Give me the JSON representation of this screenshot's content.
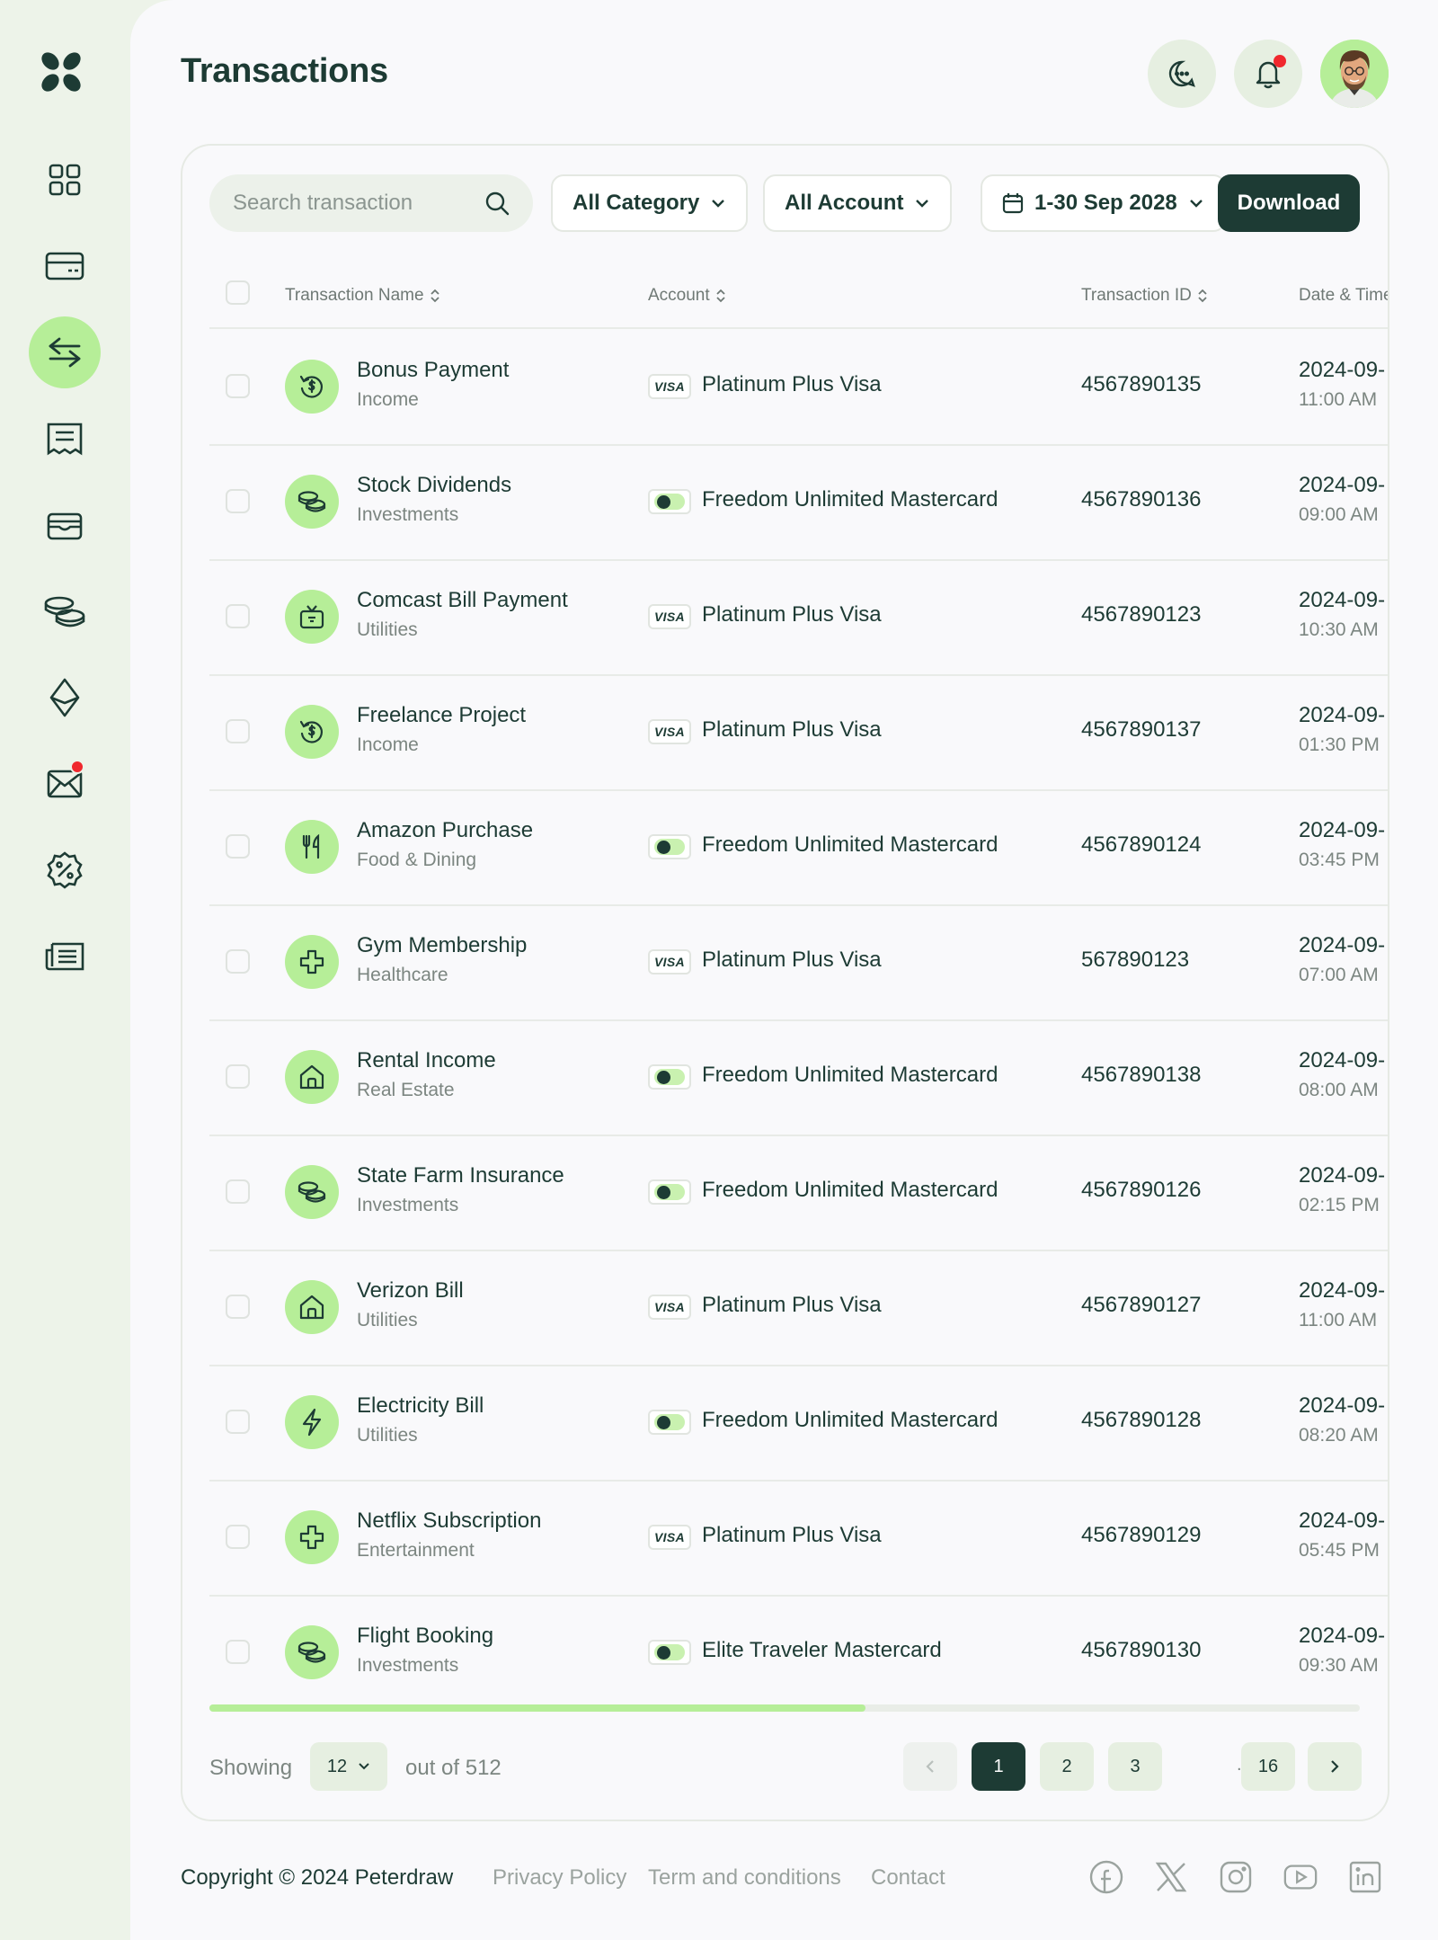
{
  "app": {
    "title": "Transactions"
  },
  "colors": {
    "brand": "#1d3b34",
    "accent": "#b6ee98",
    "notification": "#f0282e",
    "background": "#f9f9fb"
  },
  "sidebar": {
    "items": [
      {
        "id": "dashboard",
        "icon": "grid-icon",
        "active": false
      },
      {
        "id": "cards",
        "icon": "credit-card-icon",
        "active": false
      },
      {
        "id": "transactions",
        "icon": "transfer-arrows-icon",
        "active": true
      },
      {
        "id": "invoices",
        "icon": "receipt-icon",
        "active": false
      },
      {
        "id": "wallet",
        "icon": "wallet-icon",
        "active": false
      },
      {
        "id": "investments",
        "icon": "coins-icon",
        "active": false
      },
      {
        "id": "crypto",
        "icon": "ethereum-icon",
        "active": false
      },
      {
        "id": "messages",
        "icon": "mail-icon",
        "active": false,
        "badge": true
      },
      {
        "id": "discounts",
        "icon": "discount-icon",
        "active": false
      },
      {
        "id": "reports",
        "icon": "news-icon",
        "active": false
      }
    ]
  },
  "header": {
    "chat_icon": "chat-icon",
    "notification_icon": "bell-icon",
    "has_notification": true,
    "avatar": "avatar"
  },
  "toolbar": {
    "search_placeholder": "Search transaction",
    "category_filter": "All Category",
    "account_filter": "All Account",
    "date_filter": "1-30 Sep 2028",
    "download_label": "Download"
  },
  "table": {
    "columns": {
      "name": "Transaction Name",
      "account": "Account",
      "id": "Transaction ID",
      "date": "Date & Time"
    },
    "rows": [
      {
        "name": "Bonus Payment",
        "category": "Income",
        "icon": "dollar-refresh-icon",
        "card": "visa",
        "account": "Platinum Plus Visa",
        "txid": "4567890135",
        "date": "2024-09-",
        "time": "11:00 AM"
      },
      {
        "name": "Stock Dividends",
        "category": "Investments",
        "icon": "coins-icon",
        "card": "mastercard",
        "account": "Freedom Unlimited Mastercard",
        "txid": "4567890136",
        "date": "2024-09-",
        "time": "09:00 AM"
      },
      {
        "name": "Comcast Bill Payment",
        "category": "Utilities",
        "icon": "tv-icon",
        "card": "visa",
        "account": "Platinum Plus Visa",
        "txid": "4567890123",
        "date": "2024-09-",
        "time": "10:30 AM"
      },
      {
        "name": "Freelance Project",
        "category": "Income",
        "icon": "dollar-refresh-icon",
        "card": "visa",
        "account": "Platinum Plus Visa",
        "txid": "4567890137",
        "date": "2024-09-",
        "time": "01:30 PM"
      },
      {
        "name": "Amazon Purchase",
        "category": "Food & Dining",
        "icon": "fork-knife-icon",
        "card": "mastercard",
        "account": "Freedom Unlimited Mastercard",
        "txid": "4567890124",
        "date": "2024-09-",
        "time": "03:45 PM"
      },
      {
        "name": "Gym Membership",
        "category": "Healthcare",
        "icon": "medical-cross-icon",
        "card": "visa",
        "account": "Platinum Plus Visa",
        "txid": "567890123",
        "date": "2024-09-",
        "time": "07:00 AM"
      },
      {
        "name": "Rental Income",
        "category": "Real Estate",
        "icon": "house-icon",
        "card": "mastercard",
        "account": "Freedom Unlimited Mastercard",
        "txid": "4567890138",
        "date": "2024-09-",
        "time": "08:00 AM"
      },
      {
        "name": "State Farm Insurance",
        "category": "Investments",
        "icon": "coins-icon",
        "card": "mastercard",
        "account": "Freedom Unlimited Mastercard",
        "txid": "4567890126",
        "date": "2024-09-",
        "time": "02:15 PM"
      },
      {
        "name": "Verizon Bill",
        "category": "Utilities",
        "icon": "house-icon",
        "card": "visa",
        "account": "Platinum Plus Visa",
        "txid": "4567890127",
        "date": "2024-09-",
        "time": "11:00 AM"
      },
      {
        "name": "Electricity Bill",
        "category": "Utilities",
        "icon": "lightning-icon",
        "card": "mastercard",
        "account": "Freedom Unlimited Mastercard",
        "txid": "4567890128",
        "date": "2024-09-",
        "time": "08:20 AM"
      },
      {
        "name": "Netflix Subscription",
        "category": "Entertainment",
        "icon": "medical-cross-icon",
        "card": "visa",
        "account": "Platinum Plus Visa",
        "txid": "4567890129",
        "date": "2024-09-",
        "time": "05:45 PM"
      },
      {
        "name": "Flight Booking",
        "category": "Investments",
        "icon": "coins-icon",
        "card": "mastercard",
        "account": "Elite Traveler Mastercard",
        "txid": "4567890130",
        "date": "2024-09-",
        "time": "09:30 AM"
      }
    ],
    "card_labels": {
      "visa": "VISA"
    },
    "scroll_fraction": 0.57
  },
  "pagination": {
    "showing_label": "Showing",
    "per_page": "12",
    "total_label": "out of 512",
    "pages": [
      "1",
      "2",
      "3"
    ],
    "ellipsis": "...",
    "last_page": "16",
    "current": "1"
  },
  "footer": {
    "copyright": "Copyright © 2024 Peterdraw",
    "links": [
      "Privacy Policy",
      "Term and conditions",
      "Contact"
    ],
    "social": [
      "facebook-icon",
      "x-icon",
      "instagram-icon",
      "youtube-icon",
      "linkedin-icon"
    ]
  }
}
